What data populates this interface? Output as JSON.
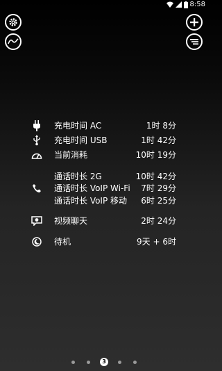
{
  "status": {
    "time": "8:58",
    "icons": [
      "wifi-icon",
      "cellular-icon",
      "battery-icon"
    ]
  },
  "toolbar": {
    "left": [
      "settings-icon",
      "graph-icon"
    ],
    "right": [
      "add-icon",
      "list-menu-icon"
    ]
  },
  "stats": [
    {
      "icon": "plug-icon",
      "label": "充电时间 AC",
      "value": "1时 8分"
    },
    {
      "icon": "usb-icon",
      "label": "充电时间 USB",
      "value": "1时 42分"
    },
    {
      "icon": "gauge-icon",
      "label": "当前消耗",
      "value": "10时 19分"
    },
    {
      "icon": "phone-icon",
      "label": "通话时长 2G",
      "value": "10时 42分"
    },
    {
      "label": "通话时长 VoIP Wi-Fi",
      "value": "7时 29分"
    },
    {
      "label": "通话时长 VoIP 移动",
      "value": "6时 25分"
    },
    {
      "icon": "video-chat-icon",
      "label": "视频聊天",
      "value": "2时 24分"
    },
    {
      "icon": "standby-moon-icon",
      "label": "待机",
      "value": "9天 + 6时"
    }
  ],
  "pager": {
    "current": "3",
    "total": 5
  }
}
